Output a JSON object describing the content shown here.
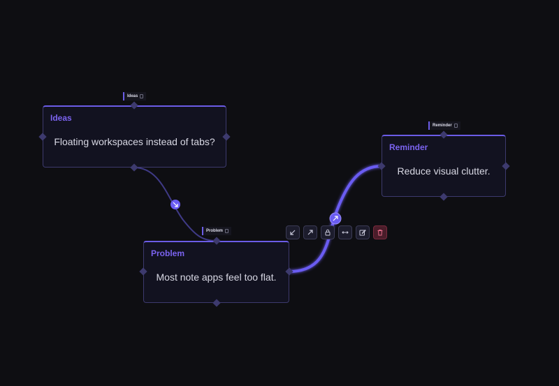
{
  "nodes": {
    "ideas": {
      "tag": "Ideas",
      "title": "Ideas",
      "body": "Floating workspaces instead of tabs?"
    },
    "problem": {
      "tag": "Problem",
      "title": "Problem",
      "body": "Most note apps feel too flat."
    },
    "reminder": {
      "tag": "Reminder",
      "title": "Reminder",
      "body": "Reduce visual clutter."
    }
  },
  "edge_handles": {
    "ideas_to_problem": "arrow-down-right-icon",
    "problem_to_reminder": "arrow-up-right-icon"
  },
  "toolbar": [
    {
      "name": "send-backward-button",
      "icon": "arrow-down-left-icon"
    },
    {
      "name": "bring-forward-button",
      "icon": "arrow-up-right-icon"
    },
    {
      "name": "lock-button",
      "icon": "lock-icon"
    },
    {
      "name": "resize-width-button",
      "icon": "arrows-horizontal-icon"
    },
    {
      "name": "edit-button",
      "icon": "edit-icon"
    },
    {
      "name": "delete-button",
      "icon": "trash-icon"
    }
  ],
  "colors": {
    "background": "#0e0e12",
    "accent": "#6b5ce7",
    "edge": "#3f3a86",
    "edge_active": "#6a5cf2",
    "delete": "#e06a86"
  }
}
